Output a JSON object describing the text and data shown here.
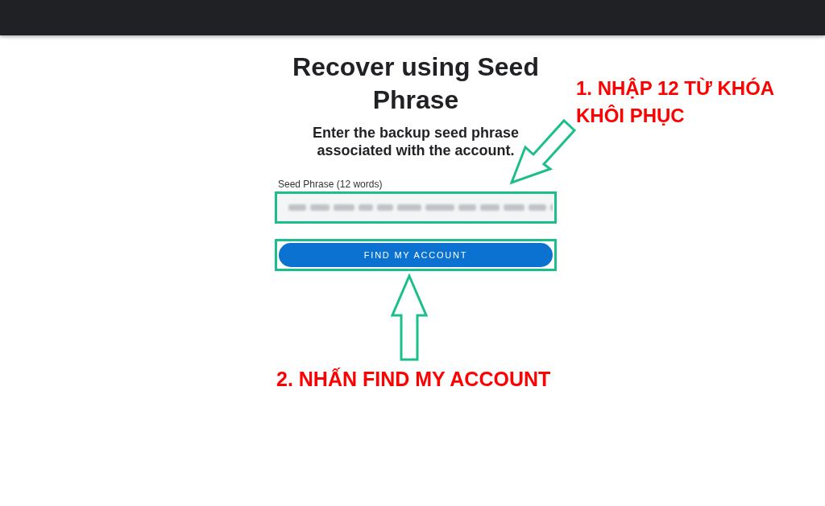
{
  "title": "Recover using Seed Phrase",
  "subtitle": "Enter the backup seed phrase associated with the account.",
  "seed_field": {
    "label": "Seed Phrase (12 words)",
    "value_blurred": true
  },
  "primary_button": {
    "label": "FIND MY ACCOUNT"
  },
  "annotations": [
    "1. NHẬP 12 TỪ KHÓA KHÔI PHỤC",
    "2. NHẤN FIND MY ACCOUNT"
  ]
}
